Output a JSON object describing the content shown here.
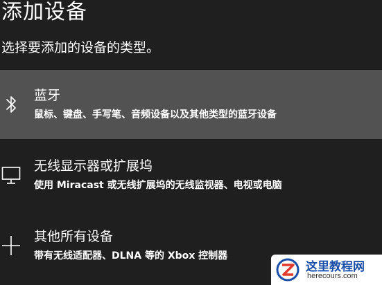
{
  "header": {
    "title": "添加设备",
    "subtitle": "选择要添加的设备的类型。"
  },
  "options": [
    {
      "icon": "bluetooth-icon",
      "title": "蓝牙",
      "description": "鼠标、键盘、手写笔、音频设备以及其他类型的蓝牙设备",
      "selected": true
    },
    {
      "icon": "monitor-icon",
      "title": "无线显示器或扩展坞",
      "description": "使用 Miracast 或无线扩展坞的无线监视器、电视或电脑",
      "selected": false
    },
    {
      "icon": "plus-icon",
      "title": "其他所有设备",
      "description": "带有无线适配器、DLNA 等的 Xbox 控制器",
      "selected": false
    }
  ],
  "watermark": {
    "name": "这里教程网",
    "url": "herecours.com"
  },
  "colors": {
    "background": "#1f1f1f",
    "selected_row": "#525252",
    "text": "#ffffff",
    "watermark_blue": "#1a4ea8"
  }
}
